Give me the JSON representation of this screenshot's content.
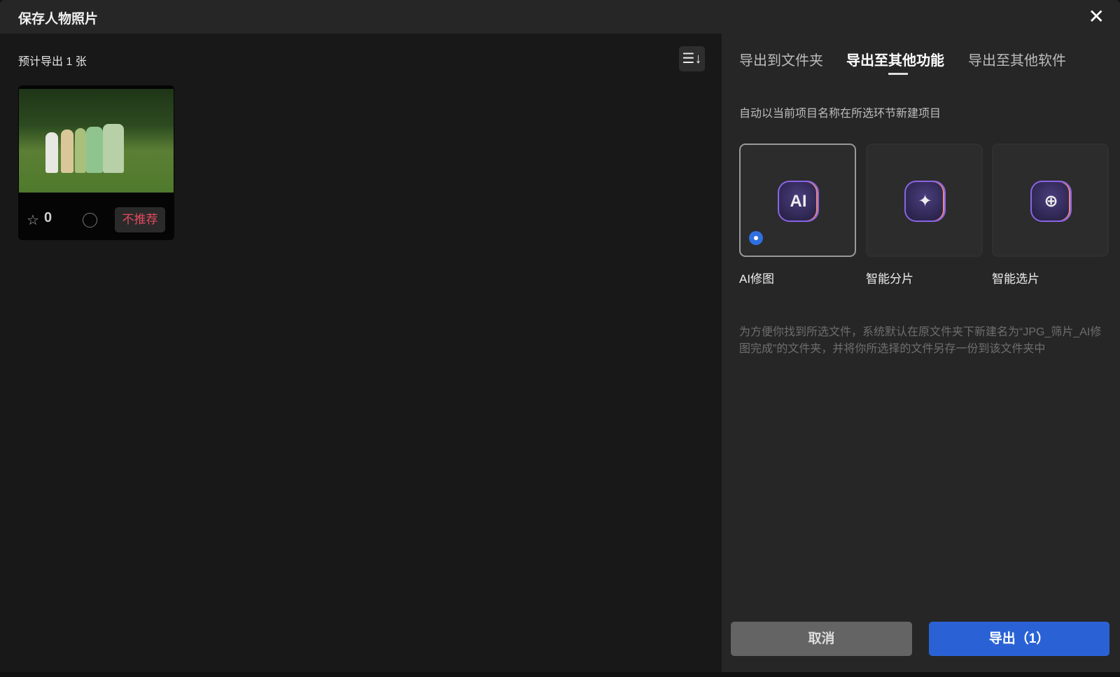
{
  "dialog": {
    "title": "保存人物照片",
    "close_icon": "close-icon"
  },
  "left": {
    "count_label": "预计导出 1 张",
    "sort_icon": "☰↓",
    "photo": {
      "rating": "0",
      "tag": "不推荐"
    }
  },
  "tabs": [
    {
      "label": "导出到文件夹"
    },
    {
      "label": "导出至其他功能",
      "active": true
    },
    {
      "label": "导出至其他软件"
    }
  ],
  "hint": "自动以当前项目名称在所选环节新建项目",
  "options": [
    {
      "label": "AI修图",
      "icon_text": "AI",
      "selected": true
    },
    {
      "label": "智能分片",
      "icon_text": "✦"
    },
    {
      "label": "智能选片",
      "icon_text": "⊕"
    }
  ],
  "description": "为方便你找到所选文件，系统默认在原文件夹下新建名为“JPG_筛片_AI修图完成”的文件夹，并将你所选择的文件另存一份到该文件夹中",
  "buttons": {
    "cancel": "取消",
    "export": "导出（1）"
  },
  "colors": {
    "accent": "#2a62d6",
    "danger": "#e24b5f"
  }
}
